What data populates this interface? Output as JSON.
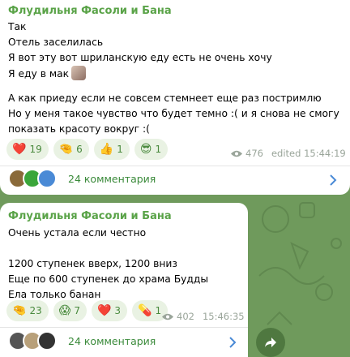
{
  "messages": [
    {
      "author": "Флудильня Фасоли и Бана",
      "text": "Так\nОтель заселилась\nЯ вот эту вот шриланскую еду есть не очень хочу\nЯ еду в мак",
      "text2": "А как приеду если не совсем стемнеет еще раз постримлю\nНо у меня такое чувство что будет темно :( и я снова не смогу\nпоказать красоту вокруг :(",
      "reactions": [
        {
          "emoji": "❤️",
          "count": "19"
        },
        {
          "emoji": "🤏",
          "count": "6"
        },
        {
          "emoji": "👍",
          "count": "1"
        },
        {
          "emoji": "😎",
          "count": "1"
        }
      ],
      "views": "476",
      "time": "edited 15:44:19",
      "comments": "24 комментария"
    },
    {
      "author": "Флудильня Фасоли и Бана",
      "text": "Очень устала если честно\n\n1200 ступенек вверх, 1200 вниз\nЕще по 600 ступенек до храма Будды\nЕла только банан",
      "reactions": [
        {
          "emoji": "🤏",
          "count": "23"
        },
        {
          "emoji": "😱",
          "count": "7"
        },
        {
          "emoji": "❤️",
          "count": "3"
        },
        {
          "emoji": "💊",
          "count": "1"
        }
      ],
      "views": "402",
      "time": "15:46:35",
      "comments": "24 комментария"
    }
  ],
  "colors": {
    "accent": "#5aa348",
    "background": "#6f9a5c",
    "reaction_bg": "#e9f2e3"
  }
}
